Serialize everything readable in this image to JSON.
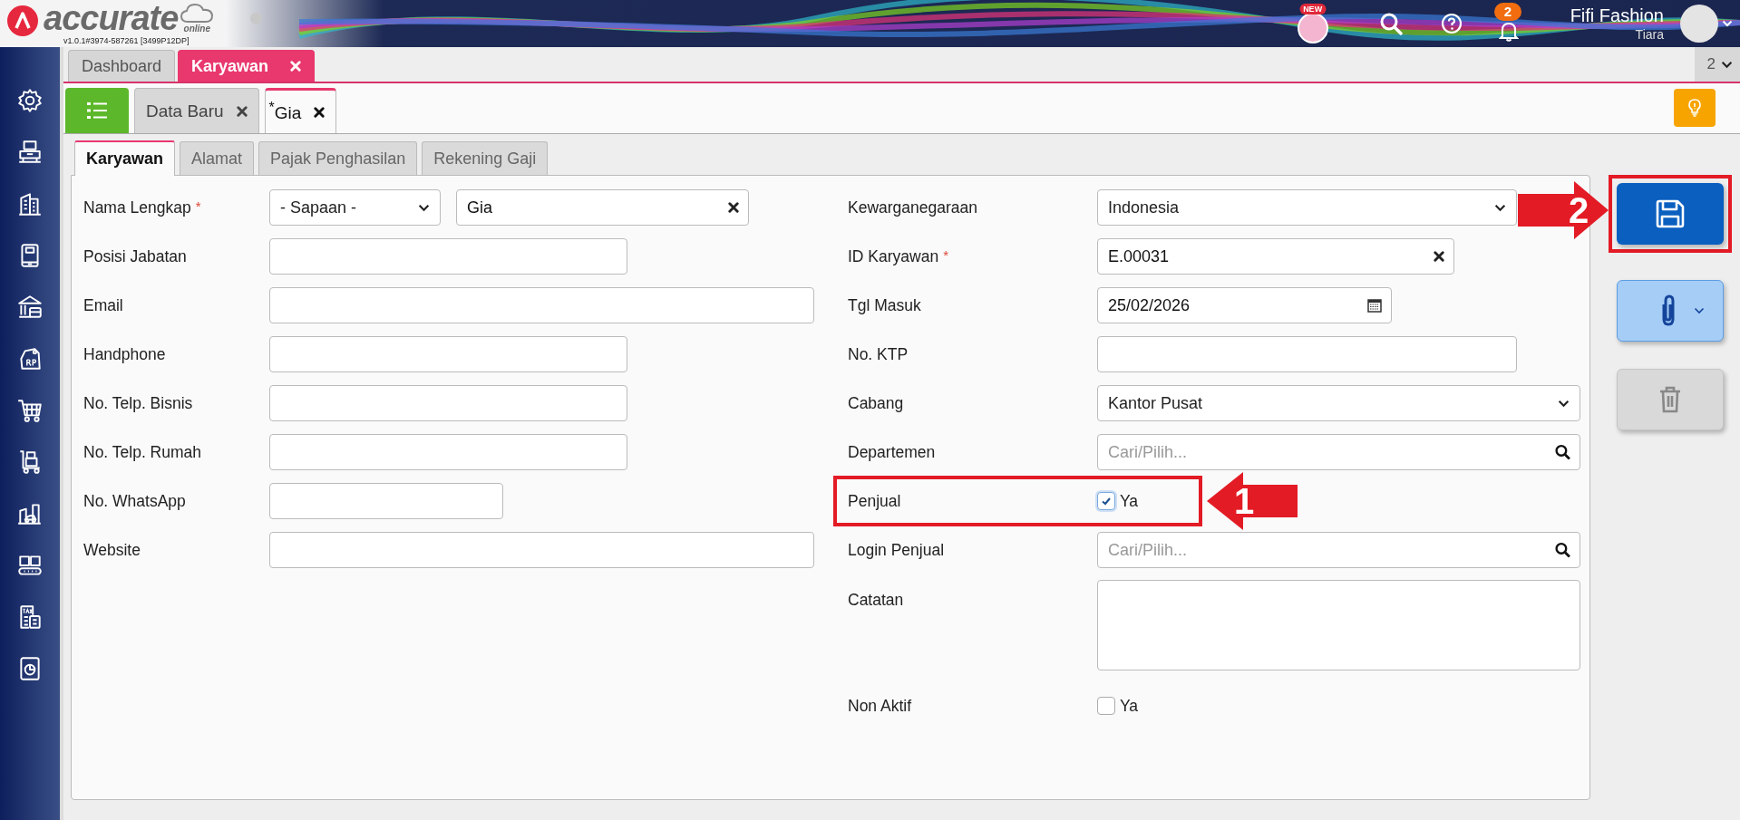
{
  "header": {
    "logo_text": "accurate",
    "logo_sub": "online",
    "version": "v1.0.1#3974-587261 [3499P12DP]",
    "new_badge": "NEW",
    "notification_count": "2",
    "company": "Fifi Fashion",
    "user": "Tiara"
  },
  "module_tabs": [
    {
      "label": "Dashboard",
      "selected": false,
      "closable": false
    },
    {
      "label": "Karyawan",
      "selected": true,
      "closable": true
    }
  ],
  "window_count": "2",
  "record_tabs": [
    {
      "label": "Data Baru",
      "selected": false
    },
    {
      "label": "$^{*}$Gia",
      "selected": true
    }
  ],
  "form_tabs": [
    {
      "label": "Karyawan",
      "selected": true
    },
    {
      "label": "Alamat",
      "selected": false
    },
    {
      "label": "Pajak Penghasilan",
      "selected": false
    },
    {
      "label": "Rekening Gaji",
      "selected": false
    }
  ],
  "left_fields": [
    {
      "kind": "name",
      "label": "Nama Lengkap",
      "required_mark": "*",
      "salutation": "- Sapaan -",
      "value": "Gia"
    },
    {
      "kind": "text",
      "label": "Posisi Jabatan"
    },
    {
      "kind": "text",
      "label": "Email"
    },
    {
      "kind": "text",
      "label": "Handphone"
    },
    {
      "kind": "text",
      "label": "No. Telp. Bisnis"
    },
    {
      "kind": "text",
      "label": "No. Telp. Rumah"
    },
    {
      "kind": "text",
      "label": "No. WhatsApp"
    },
    {
      "kind": "text",
      "label": "Website"
    }
  ],
  "right_fields": [
    {
      "kind": "select",
      "label": "Kewarganegaraan",
      "value": "Indonesia"
    },
    {
      "kind": "clearable",
      "label": "ID Karyawan",
      "required_mark": "*",
      "value": "E.00031"
    },
    {
      "kind": "date",
      "label": "Tgl Masuk",
      "value": "25/02/2026"
    },
    {
      "kind": "text",
      "label": "No. KTP"
    },
    {
      "kind": "select",
      "label": "Cabang",
      "value": "Kantor Pusat"
    },
    {
      "kind": "search",
      "label": "Departemen",
      "placeholder": "Cari/Pilih..."
    },
    {
      "kind": "checkbox",
      "label": "Penjual",
      "option": "Ya",
      "checked": true,
      "highlighted": true
    },
    {
      "kind": "search",
      "label": "Login Penjual",
      "placeholder": "Cari/Pilih..."
    },
    {
      "kind": "textarea",
      "label": "Catatan"
    },
    {
      "kind": "checkbox",
      "label": "Non Aktif",
      "option": "Ya",
      "checked": false,
      "highlighted": false
    }
  ],
  "annotations": [
    {
      "number": "1"
    },
    {
      "number": "2"
    }
  ]
}
